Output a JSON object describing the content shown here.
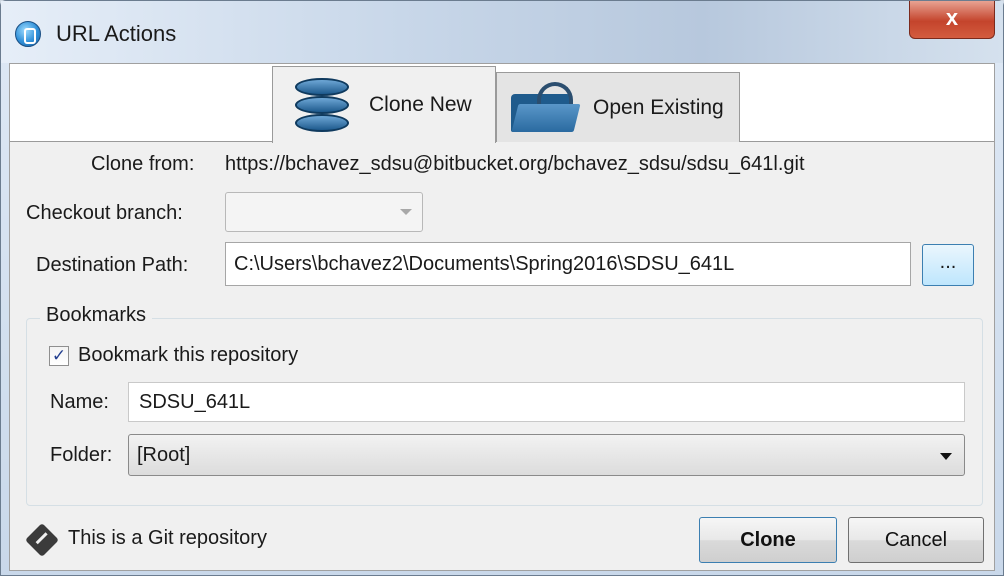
{
  "window": {
    "title": "URL Actions",
    "close_glyph": "x"
  },
  "tabs": [
    {
      "label": "Clone New",
      "icon": "database-icon",
      "active": true
    },
    {
      "label": "Open Existing",
      "icon": "folder-open-icon",
      "active": false
    }
  ],
  "form": {
    "clone_from_label": "Clone from:",
    "clone_from_url": "https://bchavez_sdsu@bitbucket.org/bchavez_sdsu/sdsu_641l.git",
    "checkout_branch_label": "Checkout branch:",
    "checkout_branch_value": "",
    "destination_label": "Destination Path:",
    "destination_value": "C:\\Users\\bchavez2\\Documents\\Spring2016\\SDSU_641L",
    "browse_label": "..."
  },
  "bookmarks": {
    "group_title": "Bookmarks",
    "checkbox_label": "Bookmark this repository",
    "checked": true,
    "check_glyph": "✓",
    "name_label": "Name:",
    "name_value": "SDSU_641L",
    "folder_label": "Folder:",
    "folder_value": "[Root]"
  },
  "footer": {
    "repo_type_text": "This is a Git repository",
    "clone_button": "Clone",
    "cancel_button": "Cancel"
  }
}
